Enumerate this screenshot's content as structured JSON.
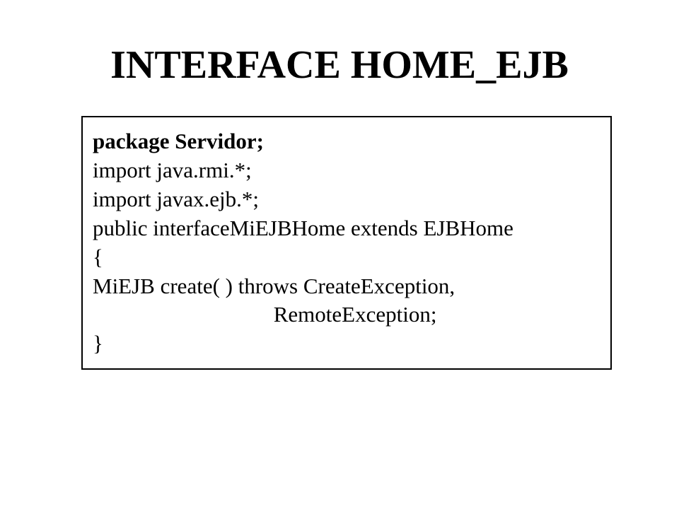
{
  "title": "INTERFACE HOME_EJB",
  "code": {
    "line1": "package Servidor;",
    "line2": "import java.rmi.*;",
    "line3": "import javax.ejb.*;",
    "line4": "",
    "line5": "public interfaceMiEJBHome extends EJBHome",
    "line6": "{",
    "line7": "MiEJB create( ) throws CreateException,",
    "line8": "                                 RemoteException;",
    "line9": "}"
  }
}
